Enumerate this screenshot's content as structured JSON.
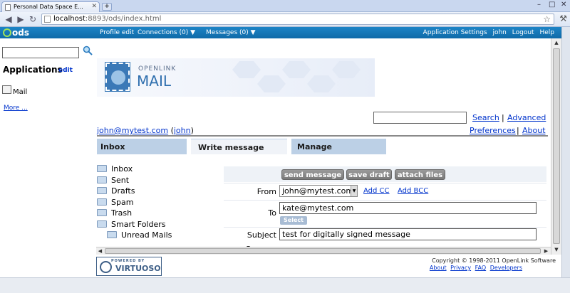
{
  "browser": {
    "tab_title": "Personal Data Space E...",
    "new_tab": "+",
    "url_host": "localhost",
    "url_rest": ":8893/ods/index.html",
    "back_icon": "◀",
    "forward_icon": "▶",
    "reload_icon": "↻"
  },
  "topnav": {
    "logo": "ods",
    "profile": "Profile edit",
    "connections": "Connections (0) ▼",
    "messages": "Messages (0) ▼",
    "app_settings": "Application Settings",
    "user": "john",
    "logout": "Logout",
    "help": "Help"
  },
  "sidebar": {
    "search_value": "",
    "title": "Applications",
    "edit": "edit",
    "mail": "Mail",
    "more": "More ..."
  },
  "banner": {
    "brand_top": "OPENLINK",
    "brand_main": "MAIL"
  },
  "header": {
    "search_value": "",
    "search": "Search",
    "separator": "|",
    "advanced": "Advanced",
    "preferences": "Preferences",
    "about": "About",
    "email": "john@mytest.com",
    "username_open": "(",
    "username": "john",
    "username_close": ")"
  },
  "tabs": {
    "inbox": "Inbox",
    "write": "Write message",
    "manage": "Manage"
  },
  "folders": {
    "inbox": "Inbox",
    "sent": "Sent",
    "drafts": "Drafts",
    "spam": "Spam",
    "trash": "Trash",
    "smart": "Smart Folders",
    "unread": "Unread Mails"
  },
  "compose": {
    "send": "send message",
    "save": "save draft",
    "attach": "attach files",
    "from_label": "From",
    "from_value": "john@mytest.com",
    "add_cc": "Add CC",
    "add_bcc": "Add BCC",
    "to_label": "To",
    "to_value": "kate@mytest.com",
    "select": "Select",
    "subject_label": "Subject",
    "subject_value": "test for digitally signed message",
    "comment_label": "Comme"
  },
  "footer": {
    "powered_by": "POWERED BY",
    "virtuoso": "VIRTUOSO",
    "copyright": "Copyright © 1998-2011 OpenLink Software",
    "about": "About",
    "privacy": "Privacy",
    "faq": "FAQ",
    "developers": "Developers"
  }
}
